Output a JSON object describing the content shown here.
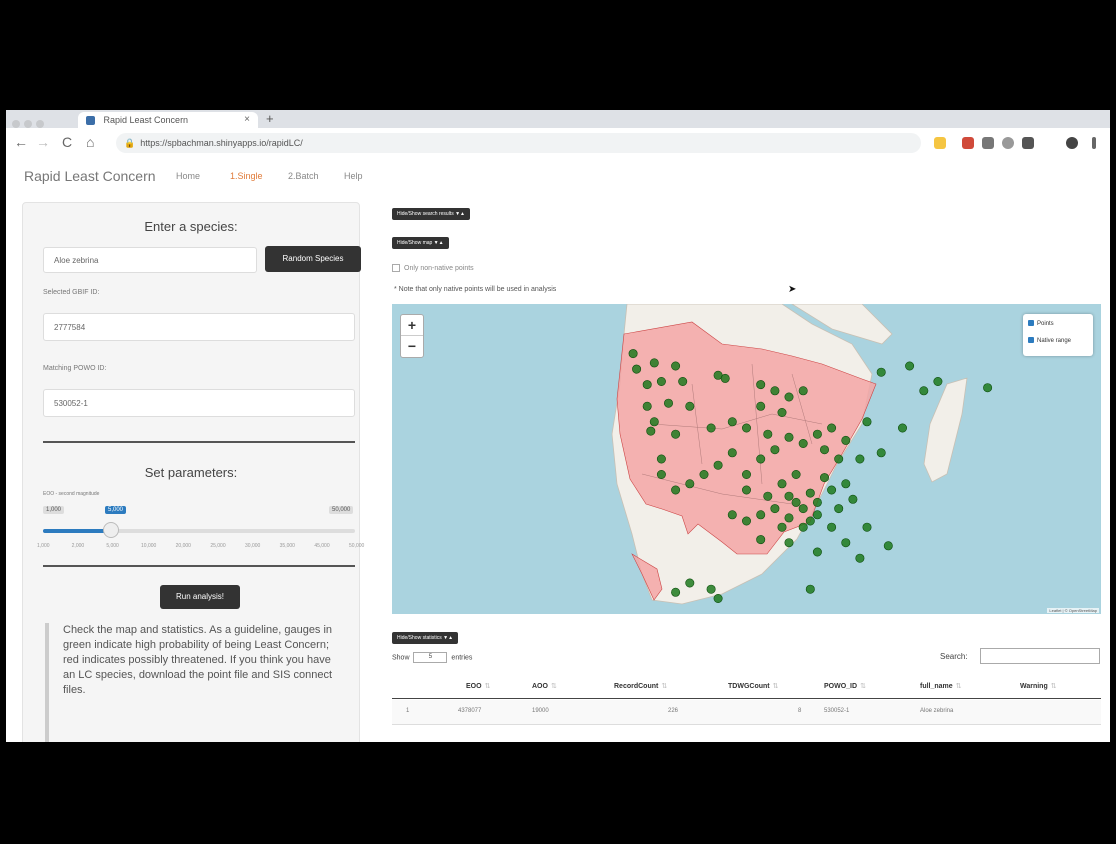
{
  "browser": {
    "tab_title": "Rapid Least Concern",
    "tab_close": "×",
    "new_tab": "+",
    "back": "←",
    "forward": "→",
    "reload": "C",
    "home": "⌂",
    "url": "https://spbachman.shinyapps.io/rapidLC/"
  },
  "app": {
    "brand": "Rapid Least Concern",
    "nav": [
      "Home",
      "1.Single",
      "2.Batch",
      "Help"
    ],
    "active_nav": "1.Single"
  },
  "sidebar": {
    "species_heading": "Enter a species:",
    "species_input": "Aloe zebrina",
    "random_button": "Random Species",
    "gbif_label": "Selected GBIF ID:",
    "gbif_value": "2777584",
    "powo_label": "Matching POWO ID:",
    "powo_value": "530052-1",
    "params_heading": "Set parameters:",
    "slider_label": "EOO - second magnitude",
    "slider_min": "1,000",
    "slider_max": "50,000",
    "slider_value": "5,000",
    "slider_ticks": [
      "1,000",
      "2,000",
      "5,000",
      "10,000",
      "20,000",
      "25,000",
      "30,000",
      "35,000",
      "45,000",
      "50,000"
    ],
    "run_button": "Run analysis!",
    "guideline": "Check the map and statistics. As a guideline, gauges in green indicate high probability of being Least Concern; red indicates possibly threatened. If you think you have an LC species, download the point file and SIS connect files."
  },
  "main": {
    "hide_search_results": "Hide/Show search results ▼▲",
    "hide_map": "Hide/Show map ▼▲",
    "only_native": "Only non-native points",
    "note": "* Note that only native points will be used in analysis",
    "zoom_in": "+",
    "zoom_out": "−",
    "legend": [
      "Points",
      "Native range"
    ],
    "attribution": "Leaflet | © OpenStreetMap",
    "hide_statistics": "Hide/Show statistics ▼▲",
    "show_prefix": "Show",
    "show_value": "5",
    "show_suffix": "entries",
    "search_label": "Search:"
  },
  "table": {
    "columns": [
      "EOO",
      "AOO",
      "RecordCount",
      "TDWGCount",
      "POWO_ID",
      "full_name",
      "Warning"
    ],
    "rows": [
      {
        "index": "1",
        "EOO": "4378077",
        "AOO": "19000",
        "RecordCount": "226",
        "TDWGCount": "8",
        "POWO_ID": "530052-1",
        "full_name": "Aloe zebrina",
        "Warning": ""
      }
    ]
  },
  "colors": {
    "map_water": "#aad3df",
    "map_land": "#f2efe9",
    "native_range": "#f4a6a6",
    "points": "#1f7a1f",
    "button_dark": "#333333",
    "active_nav": "#e07b39"
  },
  "map_points": [
    [
      0.34,
      0.16
    ],
    [
      0.37,
      0.19
    ],
    [
      0.345,
      0.21
    ],
    [
      0.4,
      0.2
    ],
    [
      0.36,
      0.26
    ],
    [
      0.38,
      0.25
    ],
    [
      0.41,
      0.25
    ],
    [
      0.36,
      0.33
    ],
    [
      0.39,
      0.32
    ],
    [
      0.42,
      0.33
    ],
    [
      0.37,
      0.38
    ],
    [
      0.365,
      0.41
    ],
    [
      0.4,
      0.42
    ],
    [
      0.45,
      0.4
    ],
    [
      0.48,
      0.38
    ],
    [
      0.46,
      0.23
    ],
    [
      0.47,
      0.24
    ],
    [
      0.52,
      0.26
    ],
    [
      0.54,
      0.28
    ],
    [
      0.56,
      0.3
    ],
    [
      0.58,
      0.28
    ],
    [
      0.52,
      0.33
    ],
    [
      0.55,
      0.35
    ],
    [
      0.5,
      0.4
    ],
    [
      0.53,
      0.42
    ],
    [
      0.56,
      0.43
    ],
    [
      0.58,
      0.45
    ],
    [
      0.54,
      0.47
    ],
    [
      0.52,
      0.5
    ],
    [
      0.48,
      0.48
    ],
    [
      0.46,
      0.52
    ],
    [
      0.44,
      0.55
    ],
    [
      0.42,
      0.58
    ],
    [
      0.38,
      0.5
    ],
    [
      0.38,
      0.55
    ],
    [
      0.4,
      0.6
    ],
    [
      0.6,
      0.42
    ],
    [
      0.62,
      0.4
    ],
    [
      0.61,
      0.47
    ],
    [
      0.63,
      0.5
    ],
    [
      0.66,
      0.5
    ],
    [
      0.57,
      0.55
    ],
    [
      0.55,
      0.58
    ],
    [
      0.5,
      0.55
    ],
    [
      0.5,
      0.6
    ],
    [
      0.53,
      0.62
    ],
    [
      0.56,
      0.62
    ],
    [
      0.59,
      0.61
    ],
    [
      0.62,
      0.6
    ],
    [
      0.64,
      0.58
    ],
    [
      0.6,
      0.64
    ],
    [
      0.58,
      0.66
    ],
    [
      0.54,
      0.66
    ],
    [
      0.52,
      0.68
    ],
    [
      0.56,
      0.69
    ],
    [
      0.6,
      0.68
    ],
    [
      0.63,
      0.66
    ],
    [
      0.65,
      0.63
    ],
    [
      0.58,
      0.72
    ],
    [
      0.55,
      0.72
    ],
    [
      0.5,
      0.7
    ],
    [
      0.48,
      0.68
    ],
    [
      0.62,
      0.72
    ],
    [
      0.67,
      0.72
    ],
    [
      0.56,
      0.77
    ],
    [
      0.52,
      0.76
    ],
    [
      0.64,
      0.77
    ],
    [
      0.7,
      0.78
    ],
    [
      0.66,
      0.82
    ],
    [
      0.6,
      0.8
    ],
    [
      0.57,
      0.64
    ],
    [
      0.59,
      0.7
    ],
    [
      0.61,
      0.56
    ],
    [
      0.64,
      0.44
    ],
    [
      0.69,
      0.48
    ],
    [
      0.72,
      0.4
    ],
    [
      0.67,
      0.38
    ],
    [
      0.75,
      0.28
    ],
    [
      0.77,
      0.25
    ],
    [
      0.84,
      0.27
    ],
    [
      0.69,
      0.22
    ],
    [
      0.73,
      0.2
    ],
    [
      0.42,
      0.9
    ],
    [
      0.45,
      0.92
    ],
    [
      0.4,
      0.93
    ],
    [
      0.46,
      0.95
    ],
    [
      0.59,
      0.92
    ]
  ]
}
